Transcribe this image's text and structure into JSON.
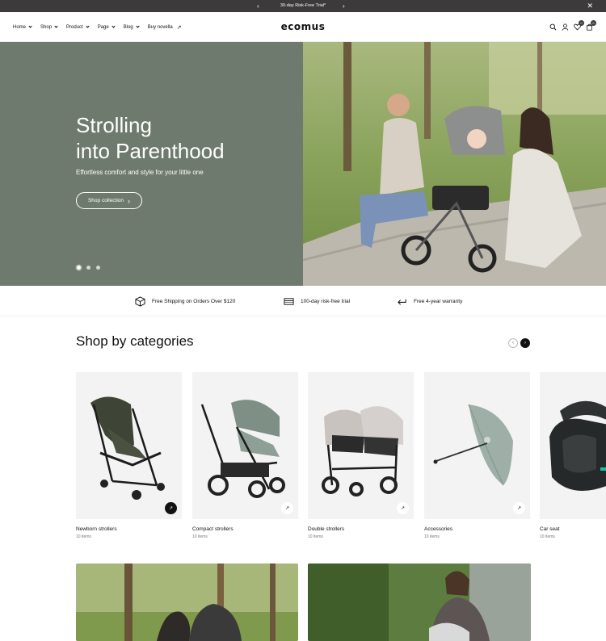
{
  "announcement": {
    "text": "30-day Risk-Free Trial*",
    "prev": "‹",
    "next": "›",
    "close": "✕"
  },
  "header": {
    "nav": [
      "Home",
      "Shop",
      "Product",
      "Page",
      "Blog"
    ],
    "buy_label": "Buy novella",
    "buy_arrow": "↗",
    "logo": "ecomus",
    "wishlist_count": "0",
    "cart_count": "0"
  },
  "hero": {
    "title_line1": "Strolling",
    "title_line2": "into Parenthood",
    "subtitle": "Effortless comfort and style for your little one",
    "cta_label": "Shop collection",
    "cta_arrow": "›"
  },
  "features": [
    {
      "label": "Free Shipping on Orders Over $120"
    },
    {
      "label": "100-day risk-free trial"
    },
    {
      "label": "Free 4-year warranty"
    }
  ],
  "categories": {
    "title": "Shop by categories",
    "prev": "‹",
    "next": "›",
    "items": [
      {
        "name": "Newborn strollers",
        "count": "10 items"
      },
      {
        "name": "Compact strollers",
        "count": "10 items"
      },
      {
        "name": "Double strollers",
        "count": "10 items"
      },
      {
        "name": "Accessories",
        "count": "10 items"
      },
      {
        "name": "Car seat",
        "count": "10 items"
      }
    ],
    "card_arrow": "↗"
  },
  "colors": {
    "hero_green": "#6e7a6d",
    "announce_bg": "#3d3a3b",
    "card_bg": "#f3f3f3"
  }
}
